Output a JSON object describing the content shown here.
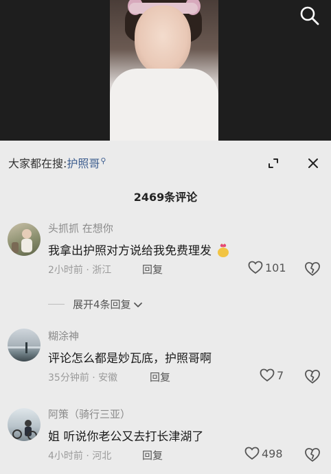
{
  "header": {
    "search_prefix": "大家都在搜:",
    "search_term": "护照哥"
  },
  "comments_count": "2469条评论",
  "comments": [
    {
      "username": "头抓抓 在想你",
      "text": "我拿出护照对方说给我免费理发",
      "meta": "2小时前 · 浙江",
      "reply": "回复",
      "likes": "101"
    },
    {
      "username": "糊涂神",
      "text": "评论怎么都是妙瓦底，护照哥啊",
      "meta": "35分钟前 · 安徽",
      "reply": "回复",
      "likes": "7"
    },
    {
      "username": "阿策（骑行三亚）",
      "text": "姐 听说你老公又去打长津湖了",
      "meta": "4小时前 · 河北",
      "reply": "回复",
      "likes": "498"
    }
  ],
  "expand_label": "展开4条回复",
  "icons": {
    "search": "search-icon",
    "minimize": "minimize-icon",
    "close": "close-icon",
    "like": "heart-icon",
    "dislike": "broken-heart-icon",
    "expand": "chevron-down-icon",
    "emoji": "money-bag-emoji"
  }
}
